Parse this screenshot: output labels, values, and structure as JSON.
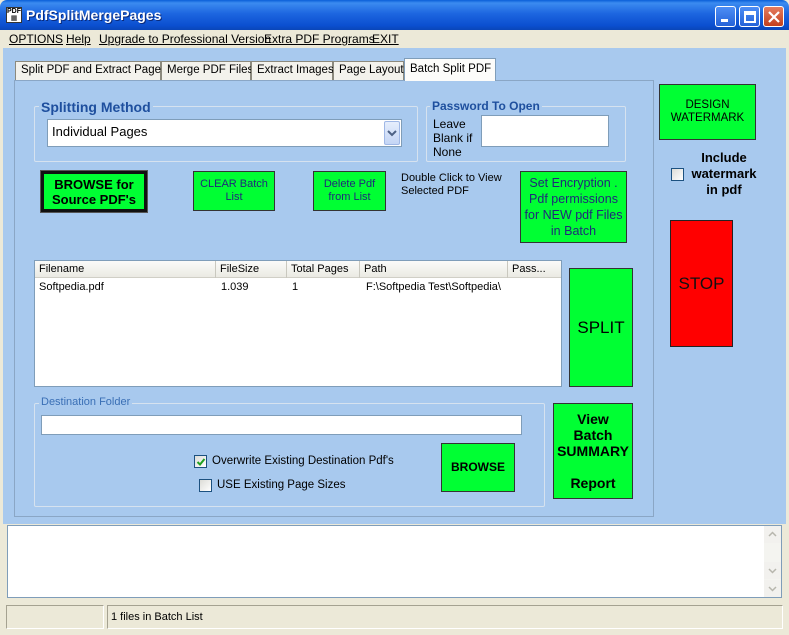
{
  "window": {
    "title": "PdfSplitMergePages",
    "icon_name": "pdf-app-icon"
  },
  "menu": {
    "items": [
      "OPTIONS",
      "Help",
      "Upgrade to Professional Version",
      "Extra PDF Programs",
      "EXIT"
    ]
  },
  "tabs": [
    "Split PDF and Extract Pages",
    "Merge PDF Files",
    "Extract Images",
    "Page Layout",
    "Batch Split PDF"
  ],
  "active_tab": "Batch Split PDF",
  "splitting": {
    "group_title": "Splitting Method",
    "selected": "Individual Pages"
  },
  "password": {
    "group_title": "Password To Open",
    "hint": "Leave Blank if None",
    "value": ""
  },
  "buttons": {
    "browse_source": "BROWSE for Source PDF's",
    "clear_batch": "CLEAR Batch List",
    "delete_pdf": "Delete Pdf from List",
    "set_encryption": "Set Encryption . Pdf permissions for NEW pdf Files in Batch",
    "design_watermark": "DESIGN WATERMARK",
    "split": "SPLIT",
    "stop": "STOP",
    "browse_dest": "BROWSE",
    "view_summary_1": "View Batch SUMMARY",
    "view_summary_2": "Report"
  },
  "double_click_hint": "Double Click to View Selected PDF",
  "watermark": {
    "label": "Include watermark in pdf",
    "checked": false
  },
  "file_list": {
    "columns": [
      "Filename",
      "FileSize",
      "Total Pages",
      "Path",
      "Pass..."
    ],
    "rows": [
      {
        "filename": "Softpedia.pdf",
        "filesize": "1.039",
        "total_pages": "1",
        "path": "F:\\Softpedia Test\\Softpedia\\",
        "pass": ""
      }
    ]
  },
  "destination": {
    "group_title": "Destination Folder",
    "value": "",
    "overwrite_label": "Overwrite Existing Destination Pdf's",
    "overwrite_checked": true,
    "use_sizes_label": "USE Existing Page Sizes",
    "use_sizes_checked": false
  },
  "log_text": "",
  "status": {
    "pane1": "",
    "pane2": "1 files in Batch List"
  },
  "colors": {
    "accent_green": "#00ff33",
    "stop_red": "#ff0000",
    "panel_blue": "#a8c9ee",
    "group_title_blue": "#1e4f9e"
  }
}
